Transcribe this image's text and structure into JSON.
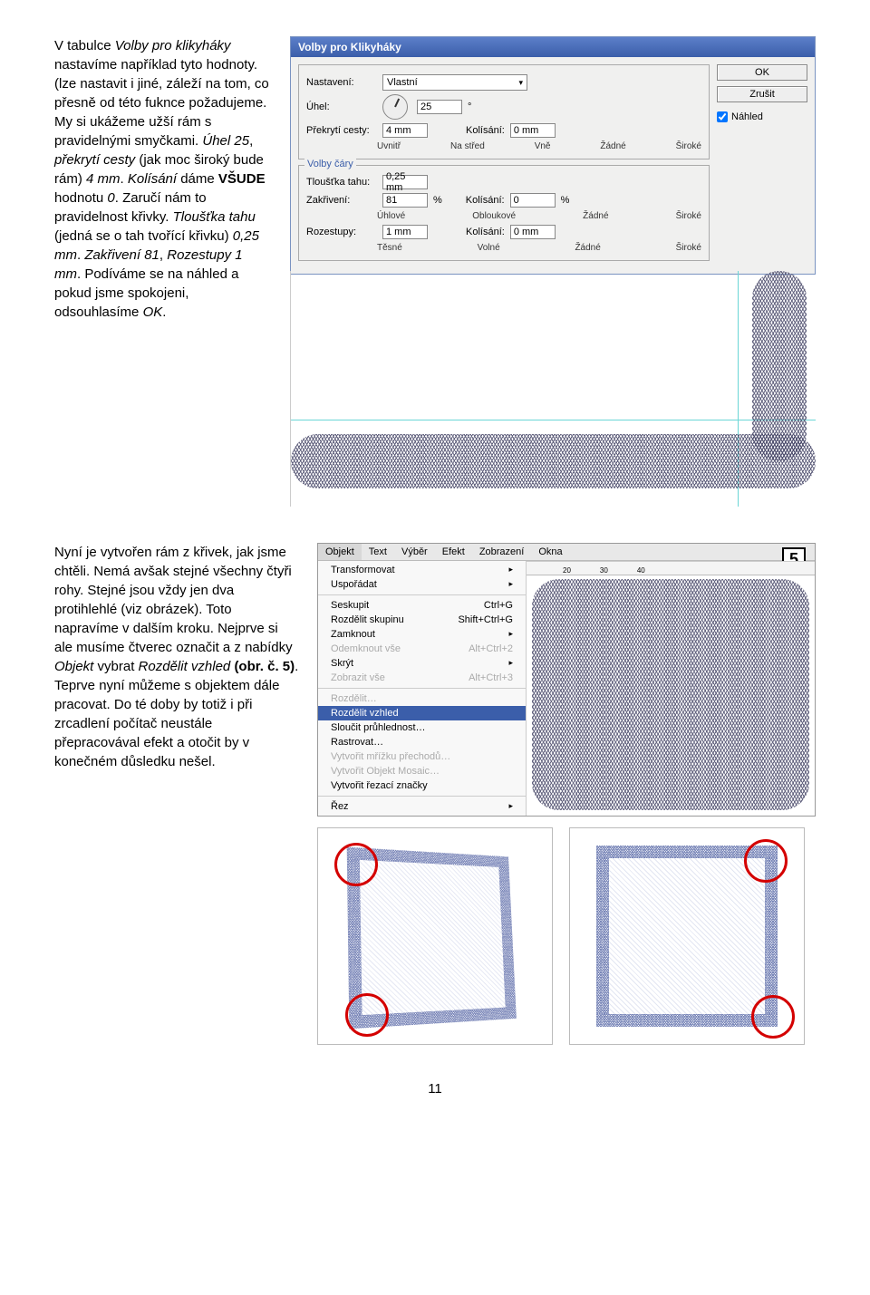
{
  "para1_pre": "V tabulce ",
  "para1_em1": "Volby pro klikyháky",
  "para1_mid1": " nastavíme například tyto hodnoty. (lze nastavit i jiné, záleží na tom, co přesně od této fuknce požadujeme. My si ukážeme užší rám s pravidelnými smyčkami. ",
  "para1_em2": "Úhel 25",
  "para1_mid2": ", ",
  "para1_em3": "překrytí cesty",
  "para1_mid3": " (jak moc široký bude rám) ",
  "para1_em4": "4 mm",
  "para1_mid4": ". ",
  "para1_em5": "Kolísání",
  "para1_mid5": " dáme ",
  "para1_strong": "VŠUDE",
  "para1_mid6": " hodnotu ",
  "para1_em6": "0",
  "para1_mid7": ". Zaručí nám to pravidelnost křivky. ",
  "para1_em7": "Tloušťka tahu",
  "para1_mid8": " (jedná se o tah tvořící křivku) ",
  "para1_em8": "0,25 mm",
  "para1_mid9": ". ",
  "para1_em9": "Zakřivení 81",
  "para1_mid10": ", ",
  "para1_em10": "Rozestupy 1 mm",
  "para1_mid11": ". Podíváme se na náhled a pokud jsme spokojeni, odsouhlasíme ",
  "para1_em11": "OK",
  "para1_end": ".",
  "para2_pre": "Nyní je vytvořen rám z křivek, jak jsme chtěli. Nemá avšak stejné všechny čtyři rohy. Stejné jsou vždy jen dva protihlehlé (viz obrázek). Toto napravíme v dalším kroku. Nejprve si ale musíme čtverec označit a z nabídky ",
  "para2_em1": "Objekt",
  "para2_mid1": " vybrat ",
  "para2_em2": "Rozdělit vzhled",
  "para2_mid2": " ",
  "para2_strong": "(obr. č. 5)",
  "para2_end": ". Teprve nyní můžeme s objektem dále pracovat. Do té doby by totiž i při zrcadlení počítač neustále přepracovával efekt a otočit by v konečném důsledku nešel.",
  "dialog": {
    "title": "Volby pro Klikyháky",
    "ok": "OK",
    "cancel": "Zrušit",
    "preview": "Náhled",
    "group1": "Nastavení:",
    "preset": "Vlastní",
    "angle_label": "Úhel:",
    "angle_val": "25",
    "angle_unit": "°",
    "overlap_label": "Překrytí cesty:",
    "overlap_val": "4 mm",
    "variation_label": "Kolísání:",
    "variation_val": "0 mm",
    "row1_a": "Uvnitř",
    "row1_b": "Na střed",
    "row1_c": "Vně",
    "row1_d": "Žádné",
    "row1_e": "Široké",
    "group2": "Volby čáry",
    "stroke_label": "Tloušťka tahu:",
    "stroke_val": "0,25 mm",
    "curv_label": "Zakřivení:",
    "curv_val": "81",
    "curv_unit": "%",
    "curv_var_label": "Kolísání:",
    "curv_var_val": "0",
    "curv_var_unit": "%",
    "row2_a": "Úhlové",
    "row2_b": "Obloukové",
    "row2_c": "Žádné",
    "row2_d": "Široké",
    "space_label": "Rozestupy:",
    "space_val": "1 mm",
    "space_var_label": "Kolísání:",
    "space_var_val": "0 mm",
    "row3_a": "Těsné",
    "row3_b": "Volné",
    "row3_c": "Žádné",
    "row3_d": "Široké"
  },
  "figure_number": "5",
  "menu": {
    "bar": {
      "m1": "Objekt",
      "m2": "Text",
      "m3": "Výběr",
      "m4": "Efekt",
      "m5": "Zobrazení",
      "m6": "Okna"
    },
    "i1": "Transformovat",
    "i2": "Uspořádat",
    "i3": "Seskupit",
    "i3s": "Ctrl+G",
    "i4": "Rozdělit skupinu",
    "i4s": "Shift+Ctrl+G",
    "i5": "Zamknout",
    "i6": "Odemknout vše",
    "i6s": "Alt+Ctrl+2",
    "i7": "Skrýt",
    "i8": "Zobrazit vše",
    "i8s": "Alt+Ctrl+3",
    "i9": "Rozdělit…",
    "i10": "Rozdělit vzhled",
    "i11": "Sloučit průhlednost…",
    "i12": "Rastrovat…",
    "i13": "Vytvořit mřížku přechodů…",
    "i14": "Vytvořit Objekt Mosaic…",
    "i15": "Vytvořit řezací značky",
    "i16": "Řez",
    "ruler": {
      "r1": "20",
      "r2": "30",
      "r3": "40"
    }
  },
  "page_number": "11"
}
